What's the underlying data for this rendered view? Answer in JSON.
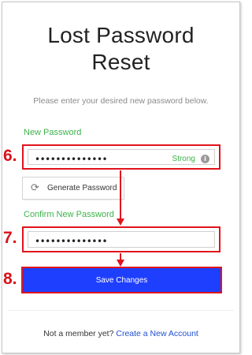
{
  "page": {
    "title_line1": "Lost Password",
    "title_line2": "Reset",
    "subtitle": "Please enter your desired new password below."
  },
  "new_password": {
    "label": "New Password",
    "value": "••••••••••••••",
    "strength": "Strong",
    "step": "6."
  },
  "generate": {
    "label": "Generate Password"
  },
  "confirm_password": {
    "label": "Confirm New Password",
    "value": "••••••••••••••",
    "step": "7."
  },
  "save": {
    "label": "Save Changes",
    "step": "8."
  },
  "footer": {
    "text": "Not a member yet?",
    "link": "Create a New Account"
  },
  "colors": {
    "accent_green": "#3cb34a",
    "annotation_red": "#e0141c",
    "button_blue": "#1f3fff",
    "link_blue": "#1f4fd1"
  },
  "icons": {
    "info": "info-icon",
    "generate": "refresh-icon",
    "arrow": "down-arrow-icon"
  }
}
